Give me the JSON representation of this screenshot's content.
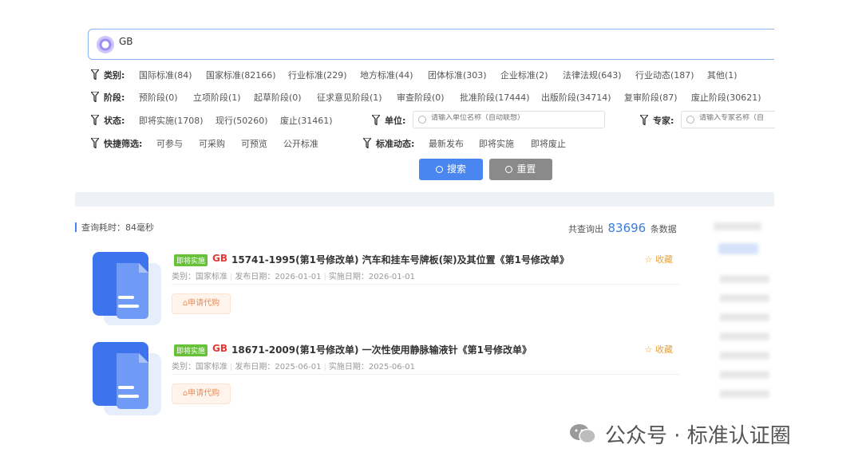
{
  "search": {
    "value": "GB"
  },
  "filters": {
    "category": {
      "label": "类别:",
      "options": [
        "国际标准(84)",
        "国家标准(82166)",
        "行业标准(229)",
        "地方标准(44)",
        "团体标准(303)",
        "企业标准(2)",
        "法律法规(643)",
        "行业动态(187)",
        "其他(1)"
      ]
    },
    "stage": {
      "label": "阶段:",
      "options": [
        "预阶段(0)",
        "立项阶段(1)",
        "起草阶段(0)",
        "征求意见阶段(1)",
        "审查阶段(0)",
        "批准阶段(17444)",
        "出版阶段(34714)",
        "复审阶段(87)",
        "废止阶段(30621)"
      ]
    },
    "status": {
      "label": "状态:",
      "options": [
        "即将实施(1708)",
        "现行(50260)",
        "废止(31461)"
      ]
    },
    "unit": {
      "label": "单位:",
      "placeholder": "请输入单位名称（自动联想）"
    },
    "expert": {
      "label": "专家:",
      "placeholder": "请输入专家名称（自"
    },
    "quick": {
      "label": "快捷筛选:",
      "options": [
        "可参与",
        "可采购",
        "可预览",
        "公开标准"
      ]
    },
    "dynamic": {
      "label": "标准动态:",
      "options": [
        "最新发布",
        "即将实施",
        "即将废止"
      ]
    }
  },
  "buttons": {
    "search": "搜索",
    "reset": "重置"
  },
  "results": {
    "query_time": "查询耗时：84毫秒",
    "total_prefix": "共查询出",
    "total": "83696",
    "total_suffix": "条数据",
    "items": [
      {
        "badge": "即将实施",
        "gb": "GB",
        "title": "15741-1995(第1号修改单)  汽车和挂车号牌板(架)及其位置《第1号修改单》",
        "category": "类别：国家标准",
        "publish": "发布日期：2026-01-01",
        "implement": "实施日期：2026-01-01",
        "fav": "☆ 收藏",
        "buy": "申请代购"
      },
      {
        "badge": "即将实施",
        "gb": "GB",
        "title": "18671-2009(第1号修改单)  一次性使用静脉输液针《第1号修改单》",
        "category": "类别：国家标准",
        "publish": "发布日期：2025-06-01",
        "implement": "实施日期：2025-06-01",
        "fav": "☆ 收藏",
        "buy": "申请代购"
      }
    ]
  },
  "watermark": "公众号 · 标准认证圈",
  "colors": {
    "accent": "#4a86f0",
    "badge": "#67c23a",
    "gb": "#e53935",
    "fav": "#e6a23c"
  }
}
